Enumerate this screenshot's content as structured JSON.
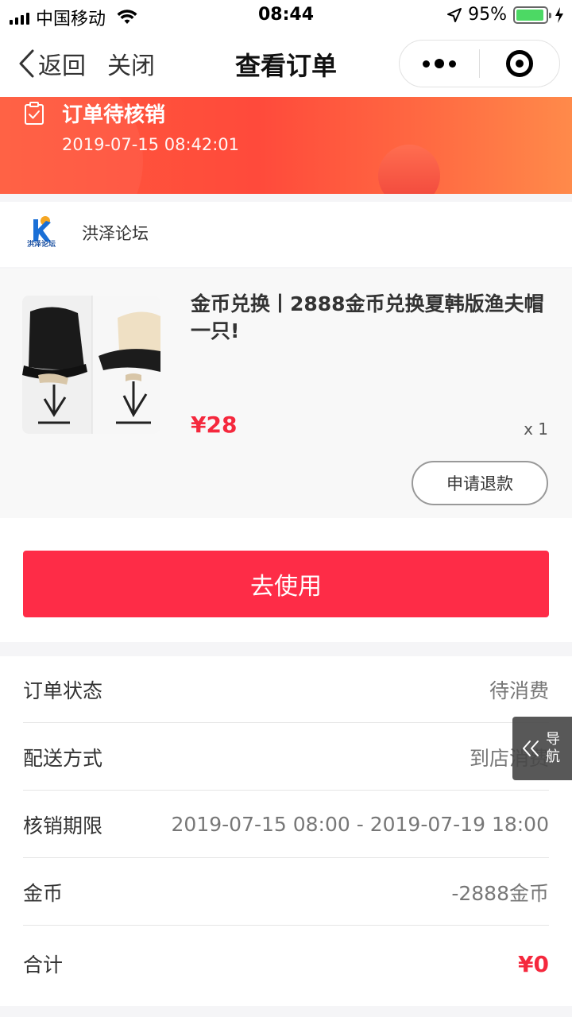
{
  "status_bar": {
    "carrier": "中国移动",
    "time": "08:44",
    "battery_percent": "95%",
    "battery_level": 0.95
  },
  "nav": {
    "back_label": "返回",
    "close_label": "关闭",
    "title": "查看订单"
  },
  "banner": {
    "status": "订单待核销",
    "timestamp": "2019-07-15 08:42:01"
  },
  "shop": {
    "logo_text": "洪泽论坛",
    "name": "洪泽论坛"
  },
  "product": {
    "title": "金币兑换丨2888金币兑换夏韩版渔夫帽一只!",
    "price": "¥28",
    "quantity": "x 1",
    "refund_label": "申请退款"
  },
  "actions": {
    "use_label": "去使用"
  },
  "details": {
    "rows": [
      {
        "label": "订单状态",
        "value": "待消费"
      },
      {
        "label": "配送方式",
        "value": "到店消费"
      },
      {
        "label": "核销期限",
        "value": "2019-07-15 08:00 - 2019-07-19 18:00"
      },
      {
        "label": "金币",
        "value": "-2888金币"
      },
      {
        "label": "合计",
        "value": "¥0"
      }
    ]
  },
  "float_nav": {
    "label": "导航"
  },
  "colors": {
    "accent_red": "#fe2c47",
    "price_red": "#f5283d",
    "banner_start": "#ff5a3c",
    "banner_end": "#ff8a4a"
  }
}
